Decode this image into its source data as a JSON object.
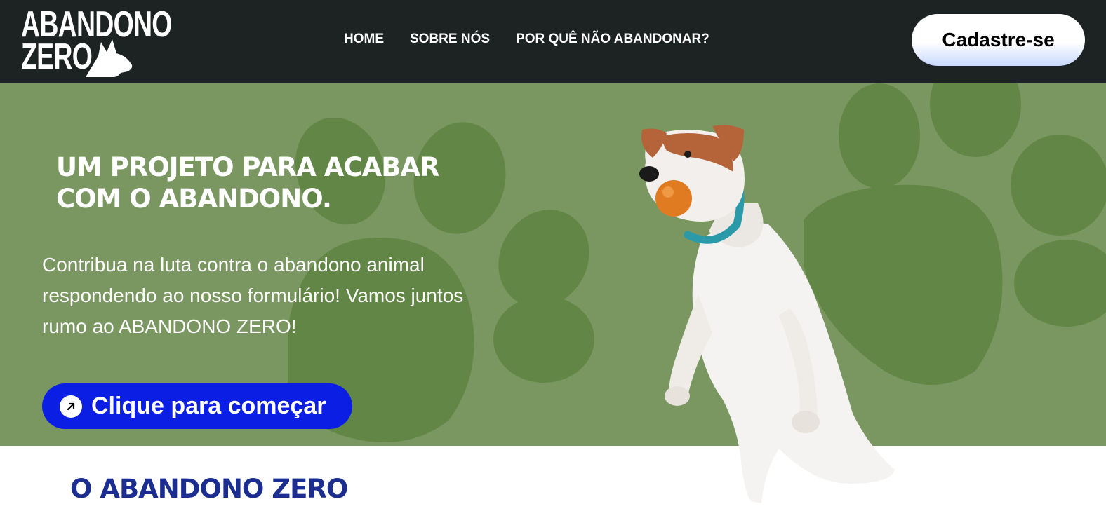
{
  "header": {
    "logo": {
      "line1": "ABANDONO",
      "line2": "ZERO",
      "icon": "dog-head-icon"
    },
    "nav": [
      {
        "label": "HOME"
      },
      {
        "label": "SOBRE NÓS"
      },
      {
        "label": "POR QUÊ NÃO ABANDONAR?"
      }
    ],
    "signup_label": "Cadastre-se"
  },
  "hero": {
    "title_line1": "UM PROJETO PARA ACABAR",
    "title_line2": "COM O ABANDONO.",
    "text_line1": "Contribua na luta contra o abandono animal",
    "text_line2": "respondendo ao nosso formulário! Vamos juntos",
    "text_line3": "rumo ao ABANDONO ZERO!",
    "cta_label": "Clique para começar",
    "cta_icon": "arrow-up-right-icon",
    "image": "jumping-dog-with-ball"
  },
  "section": {
    "title": "O ABANDONO ZERO"
  },
  "colors": {
    "header_bg": "#1c2322",
    "hero_bg": "#7a9762",
    "paw": "#618645",
    "cta_bg": "#0a1fe3",
    "section_title": "#1b2e8f"
  }
}
